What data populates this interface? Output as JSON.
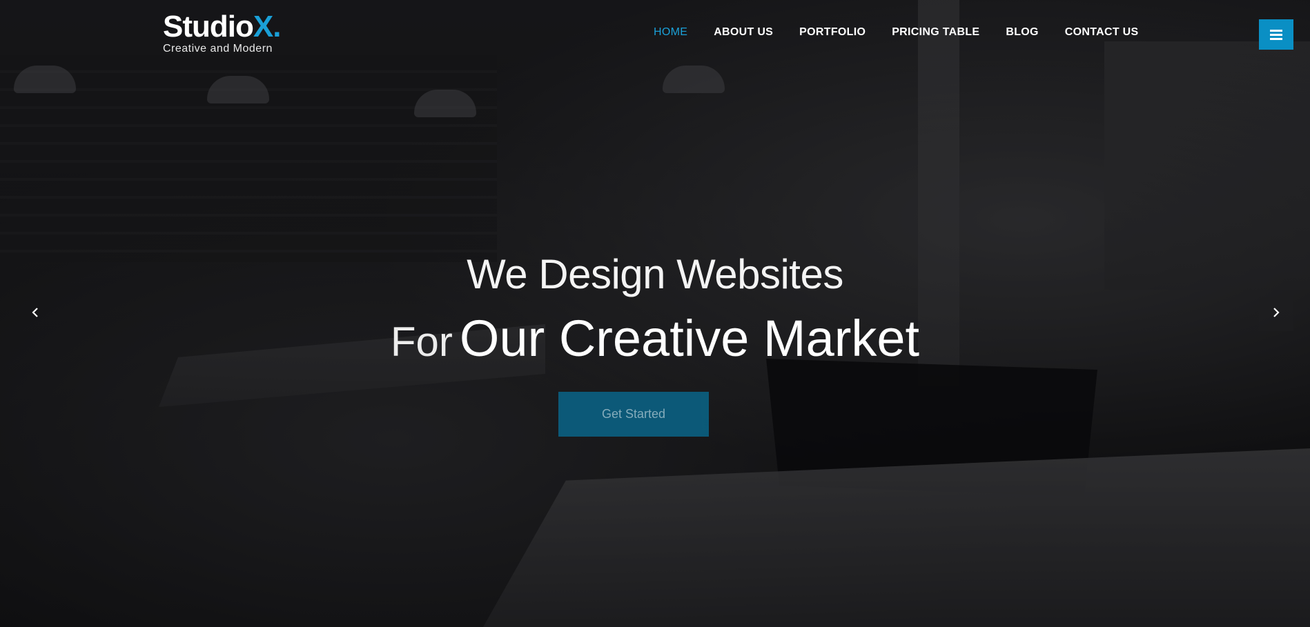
{
  "brand": {
    "logo_main": "Studio",
    "logo_accent": "X",
    "logo_dot": ".",
    "tagline": "Creative and Modern",
    "accent_color": "#1aa0d8"
  },
  "nav": {
    "items": [
      {
        "label": "HOME",
        "active": true
      },
      {
        "label": "ABOUT US",
        "active": false
      },
      {
        "label": "PORTFOLIO",
        "active": false
      },
      {
        "label": "PRICING TABLE",
        "active": false
      },
      {
        "label": "BLOG",
        "active": false
      },
      {
        "label": "CONTACT US",
        "active": false
      }
    ],
    "menu_icon": "hamburger-icon"
  },
  "hero": {
    "line1": "We Design Websites",
    "line2_prefix": "For",
    "line2_main": "Our Creative Market",
    "cta_label": "Get Started"
  },
  "slider": {
    "prev_icon": "chevron-left-icon",
    "next_icon": "chevron-right-icon"
  }
}
